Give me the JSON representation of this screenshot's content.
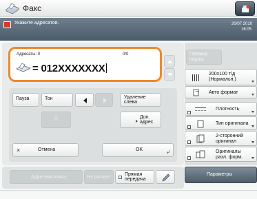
{
  "app": {
    "title": "Факс",
    "icon": "fax-icon"
  },
  "status": {
    "message": "Укажите адресатов.",
    "date": "20/07 2010",
    "time": "16:05",
    "warning_color": "#d43a2e"
  },
  "address": {
    "label": "Адресаты: 0",
    "page": "0/0",
    "value": "= 012XXXXXXX",
    "highlight_color": "#f0882c"
  },
  "keys": {
    "pause": "Пауза",
    "tone": "Тон",
    "delete_left": "Удаление слева",
    "r": "R",
    "extra_address": "Доп. адрес",
    "cancel": "Отмена",
    "ok": "OK"
  },
  "bottom_left": {
    "address_book": "Адресная книга",
    "on_hook": "На рычаге",
    "direct_send": "Прямая передача"
  },
  "right_panel": {
    "prev_settings": "Предыд. парам.",
    "resolution": "200x100 т/д (Нормальн.)",
    "auto_format": "Авто формат",
    "density": "Плотность",
    "original_type": "Тип оригинала",
    "two_sided": "2-сторонний оригинал",
    "mixed_originals": "Оригиналы разл. форм.",
    "parameters": "Параметры"
  }
}
